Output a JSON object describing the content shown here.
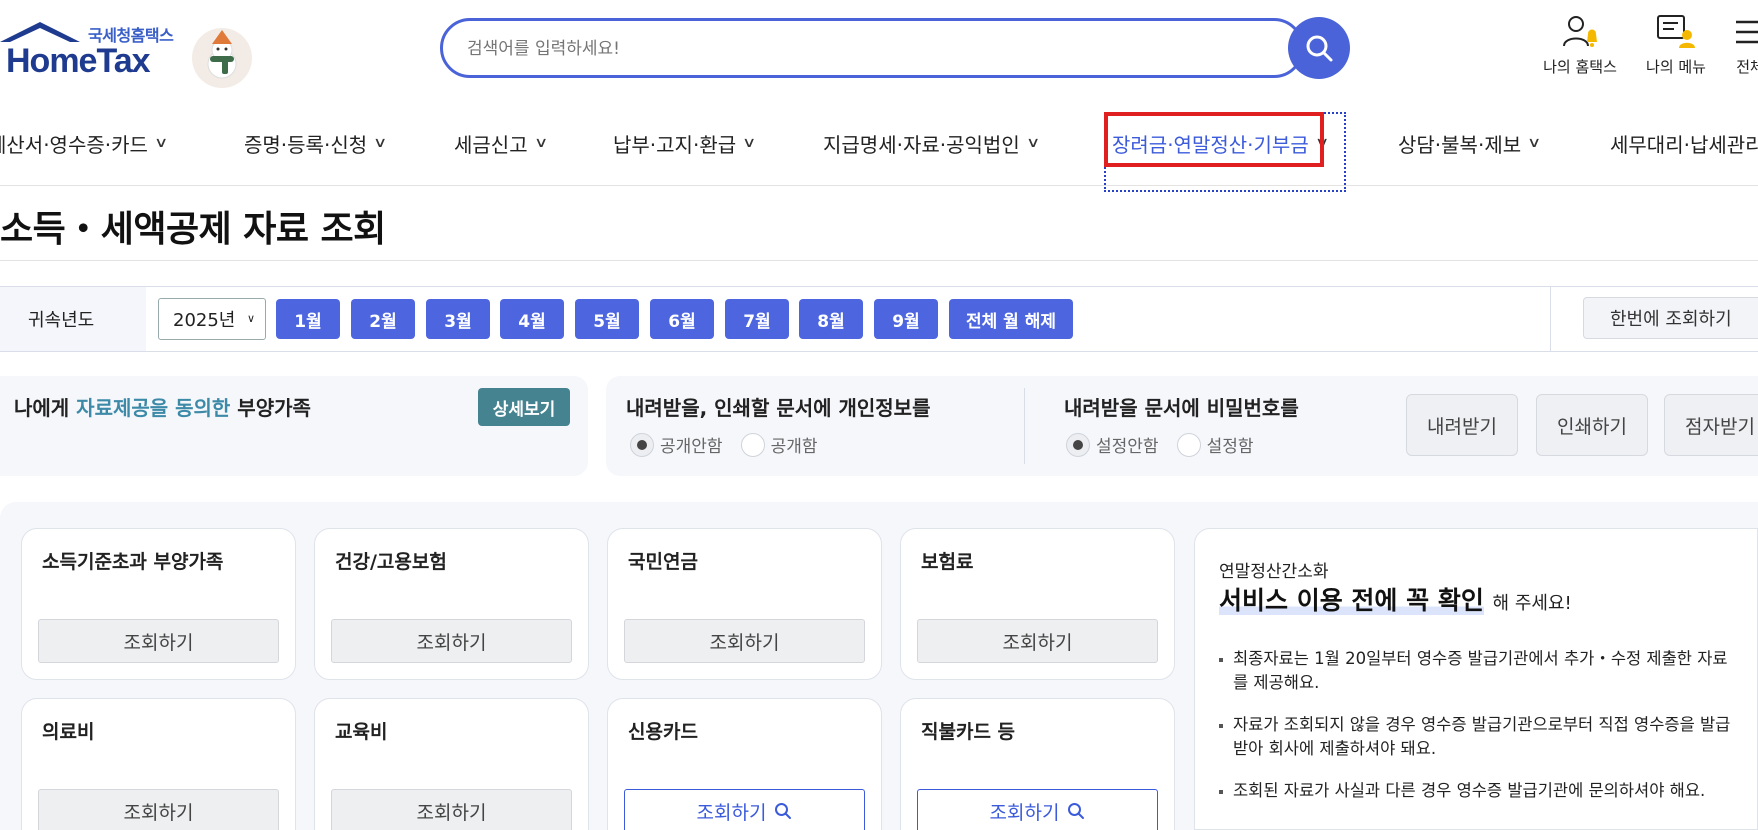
{
  "header": {
    "logo_sub": "국세청홈택스",
    "logo_main": "HomeTax",
    "search_placeholder": "검색어를 입력하세요!",
    "utils": [
      {
        "label": "나의 홈택스",
        "icon": "user-bell-icon"
      },
      {
        "label": "나의 메뉴",
        "icon": "chat-user-icon"
      },
      {
        "label": "전체",
        "icon": "menu-icon"
      }
    ]
  },
  "nav": {
    "items": [
      {
        "label": "계산서·영수증·카드",
        "active": false
      },
      {
        "label": "증명·등록·신청",
        "active": false
      },
      {
        "label": "세금신고",
        "active": false
      },
      {
        "label": "납부·고지·환급",
        "active": false
      },
      {
        "label": "지급명세·자료·공익법인",
        "active": false
      },
      {
        "label": "장려금·연말정산·기부금",
        "active": true
      },
      {
        "label": "상담·불복·제보",
        "active": false
      },
      {
        "label": "세무대리·납세관리",
        "active": false
      }
    ],
    "highlight_color": "#e02020",
    "active_color": "#3b5bdb"
  },
  "page_title": "소득・세액공제 자료 조회",
  "year_bar": {
    "label": "귀속년도",
    "selected_year": "2025년",
    "months": [
      "1월",
      "2월",
      "3월",
      "4월",
      "5월",
      "6월",
      "7월",
      "8월",
      "9월"
    ],
    "clear_all": "전체 월 해제",
    "onetime": "한번에 조회하기"
  },
  "consent": {
    "prefix": "나에게 ",
    "highlight": "자료제공을 동의한",
    "suffix": " 부양가족",
    "detail_button": "상세보기"
  },
  "doc_options": {
    "privacy_question": "내려받을, 인쇄할 문서에 개인정보를",
    "privacy_options": [
      {
        "label": "공개안함",
        "selected": true
      },
      {
        "label": "공개함",
        "selected": false
      }
    ],
    "password_question": "내려받을 문서에 비밀번호를",
    "password_options": [
      {
        "label": "설정안함",
        "selected": true
      },
      {
        "label": "설정함",
        "selected": false
      }
    ],
    "buttons": [
      "내려받기",
      "인쇄하기",
      "점자받기"
    ]
  },
  "cards": [
    {
      "title": "소득기준초과 부양가족",
      "button": "조회하기",
      "primary": false
    },
    {
      "title": "건강/고용보험",
      "button": "조회하기",
      "primary": false
    },
    {
      "title": "국민연금",
      "button": "조회하기",
      "primary": false
    },
    {
      "title": "보험료",
      "button": "조회하기",
      "primary": false
    },
    {
      "title": "의료비",
      "button": "조회하기",
      "primary": false
    },
    {
      "title": "교육비",
      "button": "조회하기",
      "primary": false
    },
    {
      "title": "신용카드",
      "button": "조회하기",
      "primary": true
    },
    {
      "title": "직불카드 등",
      "button": "조회하기",
      "primary": true
    }
  ],
  "notice": {
    "small": "연말정산간소화",
    "big": "서비스 이용 전에 꼭 확인",
    "big_tail": "해 주세요!",
    "items": [
      "최종자료는 1월 20일부터 영수증 발급기관에서 추가・수정 제출한 자료를 제공해요.",
      "자료가 조회되지 않을 경우 영수증 발급기관으로부터 직접 영수증을 발급받아 회사에 제출하셔야 돼요.",
      "조회된 자료가 사실과 다른 경우 영수증 발급기관에 문의하셔야 해요."
    ]
  }
}
